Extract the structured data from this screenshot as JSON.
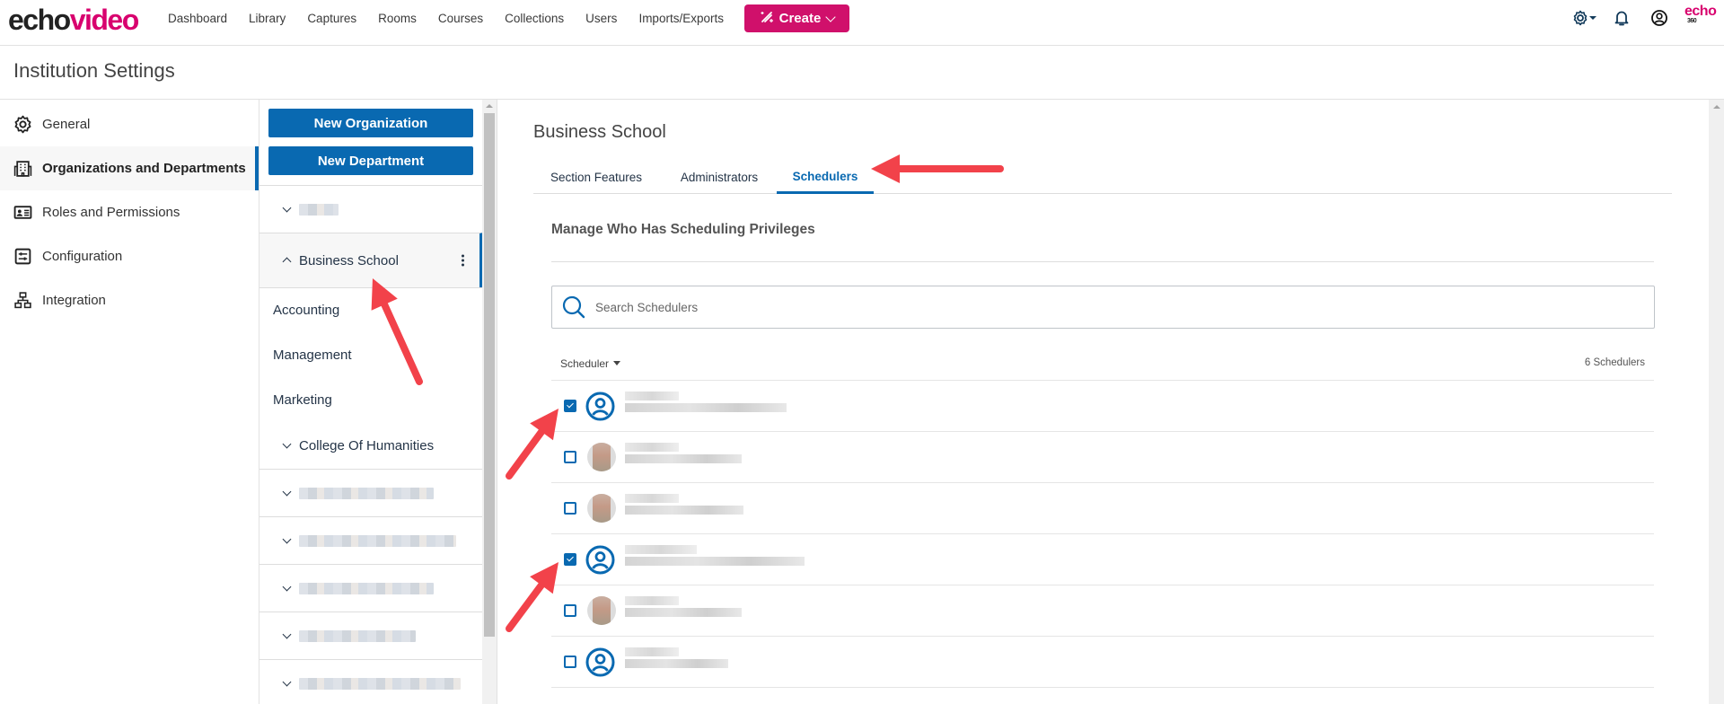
{
  "app": {
    "logo": {
      "part1": "echo",
      "part2": "video"
    },
    "brand_color": "#d8006e",
    "accent_color": "#0969b1"
  },
  "topnav": {
    "links": [
      "Dashboard",
      "Library",
      "Captures",
      "Rooms",
      "Courses",
      "Collections",
      "Users",
      "Imports/Exports"
    ],
    "create_label": "Create",
    "icons": [
      "gear-icon",
      "bell-icon",
      "user-circle-icon"
    ],
    "echo360": {
      "word": "echo",
      "num": "360"
    }
  },
  "page": {
    "title": "Institution Settings"
  },
  "sidebar": {
    "items": [
      {
        "label": "General",
        "icon": "gear-icon",
        "active": false
      },
      {
        "label": "Organizations and Departments",
        "icon": "building-icon",
        "active": true
      },
      {
        "label": "Roles and Permissions",
        "icon": "id-card-icon",
        "active": false
      },
      {
        "label": "Configuration",
        "icon": "sliders-icon",
        "active": false
      },
      {
        "label": "Integration",
        "icon": "network-icon",
        "active": false
      }
    ]
  },
  "tree": {
    "new_org_label": "New Organization",
    "new_dept_label": "New Department",
    "items": [
      {
        "label": "[redacted]",
        "expanded": false,
        "redacted": true
      },
      {
        "label": "Business School",
        "expanded": true,
        "active": true
      },
      {
        "label": "Accounting",
        "child": true
      },
      {
        "label": "Management",
        "child": true
      },
      {
        "label": "Marketing",
        "child": true
      },
      {
        "label": "College Of Humanities",
        "expanded": false
      },
      {
        "label": "[redacted]",
        "expanded": false,
        "redacted": true
      },
      {
        "label": "[redacted]",
        "expanded": false,
        "redacted": true
      },
      {
        "label": "[redacted]",
        "expanded": false,
        "redacted": true
      },
      {
        "label": "[redacted]",
        "expanded": false,
        "redacted": true
      },
      {
        "label": "[redacted]",
        "expanded": false,
        "redacted": true
      }
    ]
  },
  "main": {
    "title": "Business School",
    "tabs": [
      {
        "label": "Section Features",
        "active": false
      },
      {
        "label": "Administrators",
        "active": false
      },
      {
        "label": "Schedulers",
        "active": true
      }
    ],
    "section_title": "Manage Who Has Scheduling Privileges",
    "search_placeholder": "Search Schedulers",
    "search_value": "",
    "list_header": {
      "sort_label": "Scheduler",
      "count": "6 Schedulers"
    },
    "schedulers": [
      {
        "name": "[redacted]",
        "checked": true,
        "avatar": "default"
      },
      {
        "name": "[redacted]",
        "checked": false,
        "avatar": "photo"
      },
      {
        "name": "[redacted]",
        "checked": false,
        "avatar": "photo"
      },
      {
        "name": "[redacted]",
        "checked": true,
        "avatar": "default"
      },
      {
        "name": "[redacted]",
        "checked": false,
        "avatar": "photo"
      },
      {
        "name": "[redacted]",
        "checked": false,
        "avatar": "default"
      }
    ]
  },
  "annotations": {
    "color": "#f2424a",
    "arrows": [
      "points-to-business-school-tree-item",
      "points-to-schedulers-tab",
      "points-to-scheduler-row-1-checkbox",
      "points-to-scheduler-row-4-checkbox"
    ]
  }
}
